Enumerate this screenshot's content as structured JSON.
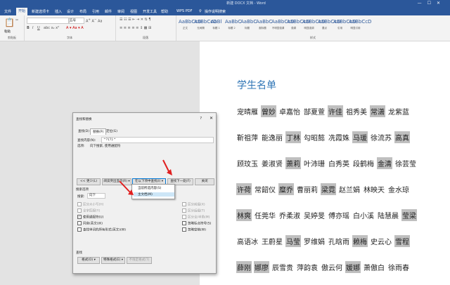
{
  "window": {
    "title": "新建 DOCX 文档 - Word",
    "controls": [
      "—",
      "☐",
      "✕"
    ]
  },
  "menu": {
    "tabs": [
      "文件",
      "开始",
      "新建选项卡",
      "插入",
      "设计",
      "布局",
      "引用",
      "邮件",
      "审阅",
      "视图",
      "开发工具",
      "帮助",
      "WPS PDF"
    ],
    "active": "开始",
    "tell_me": "操作说明搜索"
  },
  "ribbon": {
    "clipboard": {
      "label": "剪贴板",
      "paste": "粘贴"
    },
    "font": {
      "label": "字体",
      "font_name": "",
      "size": "五号"
    },
    "paragraph": {
      "label": "段落"
    },
    "styles": {
      "label": "样式",
      "items": [
        {
          "sample": "AaBbCcD",
          "name": "正文"
        },
        {
          "sample": "AaBbCcD",
          "name": "无间隔"
        },
        {
          "sample": "AaBl",
          "name": "标题 1"
        },
        {
          "sample": "AaBbC",
          "name": "标题 2"
        },
        {
          "sample": "AaBbC",
          "name": "标题"
        },
        {
          "sample": "AaBbC",
          "name": "副标题"
        },
        {
          "sample": "AaBbCcD",
          "name": "不明显强调"
        },
        {
          "sample": "AaBbCcD",
          "name": "强调"
        },
        {
          "sample": "AaBbCcD",
          "name": "明显强调"
        },
        {
          "sample": "AaBbCcD",
          "name": "要点"
        },
        {
          "sample": "AaBbCcD",
          "name": "引用"
        },
        {
          "sample": "AaBbCcD",
          "name": "明显引用"
        }
      ]
    }
  },
  "document": {
    "title": "学生名单",
    "rows": [
      [
        {
          "t": "宠晴雁",
          "h": false
        },
        {
          "t": "曾妙",
          "h": true
        },
        {
          "t": "卓嘉怡",
          "h": false
        },
        {
          "t": "郜夏萱",
          "h": false
        },
        {
          "t": "许佳",
          "h": true
        },
        {
          "t": "祖秀美",
          "h": false
        },
        {
          "t": "常潇",
          "h": true
        },
        {
          "t": "龙紫蓝",
          "h": false
        }
      ],
      [
        {
          "t": "靳祖萍",
          "h": false
        },
        {
          "t": "能逸丽",
          "h": false
        },
        {
          "t": "丁林",
          "h": true
        },
        {
          "t": "勾昭懿",
          "h": false
        },
        {
          "t": "冼霞姝",
          "h": false
        },
        {
          "t": "马瑗",
          "h": true
        },
        {
          "t": "徐流苏",
          "h": false
        },
        {
          "t": "高真",
          "h": true
        }
      ],
      [
        {
          "t": "顾玟玉",
          "h": false
        },
        {
          "t": "姜淑贤",
          "h": false
        },
        {
          "t": "萧莉",
          "h": true
        },
        {
          "t": "叶沛珊",
          "h": false
        },
        {
          "t": "白秀英",
          "h": false
        },
        {
          "t": "段鹤梅",
          "h": false
        },
        {
          "t": "金清",
          "h": true
        },
        {
          "t": "徐芸莹",
          "h": false
        }
      ],
      [
        {
          "t": "许荷",
          "h": true
        },
        {
          "t": "常韶仪",
          "h": false
        },
        {
          "t": "糜乔",
          "h": true
        },
        {
          "t": "曹丽莉",
          "h": false
        },
        {
          "t": "梁霓",
          "h": true
        },
        {
          "t": "赵兰娟",
          "h": false
        },
        {
          "t": "林映天",
          "h": false
        },
        {
          "t": "金水琼",
          "h": false
        }
      ],
      [
        {
          "t": "林爽",
          "h": true
        },
        {
          "t": "任莞华",
          "h": false
        },
        {
          "t": "乔柔淑",
          "h": false
        },
        {
          "t": "吴婷旻",
          "h": false
        },
        {
          "t": "傅亦瑶",
          "h": false
        },
        {
          "t": "白小溪",
          "h": false
        },
        {
          "t": "陆慧晨",
          "h": false
        },
        {
          "t": "莹梁",
          "h": true
        }
      ],
      [
        {
          "t": "高语冰",
          "h": false
        },
        {
          "t": "王蔚星",
          "h": false
        },
        {
          "t": "马莹",
          "h": true
        },
        {
          "t": "罗维娟",
          "h": false
        },
        {
          "t": "孔晗雨",
          "h": false
        },
        {
          "t": "赖梅",
          "h": true
        },
        {
          "t": "史云心",
          "h": false
        },
        {
          "t": "雪程",
          "h": true
        }
      ],
      [
        {
          "t": "薛刚",
          "h": true
        },
        {
          "t": "娜廖",
          "h": true
        },
        {
          "t": "辰雪贵",
          "h": false
        },
        {
          "t": "萍韵袁",
          "h": false
        },
        {
          "t": "傲云何",
          "h": false
        },
        {
          "t": "媛娜",
          "h": true
        },
        {
          "t": "萧傲白",
          "h": false
        },
        {
          "t": "徐雨春",
          "h": false
        }
      ]
    ]
  },
  "dialog": {
    "title": "查找和替换",
    "help": "?",
    "close": "✕",
    "tabs": [
      "查找(D)",
      "替换(P)",
      "定位(G)"
    ],
    "find_label": "查找内容(N):",
    "find_value": "^?{?}^",
    "options_label": "选项:",
    "options_value": "向下搜索, 使用通配符",
    "buttons": {
      "less": "<< 更少(L)",
      "reading_highlight": "阅读突出显示(R) ▾",
      "find_in": "在以下项中查找(I) ▾",
      "find_next": "查找下一处(F)",
      "close": "关闭"
    },
    "find_in_menu": [
      "当前所选内容(S)",
      "主文档(M)"
    ],
    "search_options_label": "搜索选项",
    "search_label": "搜索:",
    "search_value": "向下",
    "left_checks": [
      {
        "label": "区分大小写(H)",
        "checked": false,
        "disabled": true
      },
      {
        "label": "全字匹配(Y)",
        "checked": false,
        "disabled": true
      },
      {
        "label": "使用通配符(U)",
        "checked": true,
        "disabled": false
      },
      {
        "label": "同音(英文)(K)",
        "checked": false,
        "disabled": false
      },
      {
        "label": "查找单词的所有形式(英文)(W)",
        "checked": false,
        "disabled": false
      }
    ],
    "right_checks": [
      {
        "label": "区分前缀(X)",
        "checked": false,
        "disabled": true
      },
      {
        "label": "区分后缀(T)",
        "checked": false,
        "disabled": true
      },
      {
        "label": "区分全/半角(M)",
        "checked": false,
        "disabled": true
      },
      {
        "label": "忽略标点符号(S)",
        "checked": false,
        "disabled": false
      },
      {
        "label": "忽略空格(W)",
        "checked": false,
        "disabled": false
      }
    ],
    "find_section_label": "查找",
    "bottom_buttons": [
      "格式(O) ▾",
      "特殊格式(E) ▾",
      "不限定格式(T)"
    ]
  },
  "colors": {
    "accent": "#2b579a",
    "title_blue": "#2e74b5",
    "arrow_red": "#e02020",
    "highlight": "#bfbfbf"
  }
}
